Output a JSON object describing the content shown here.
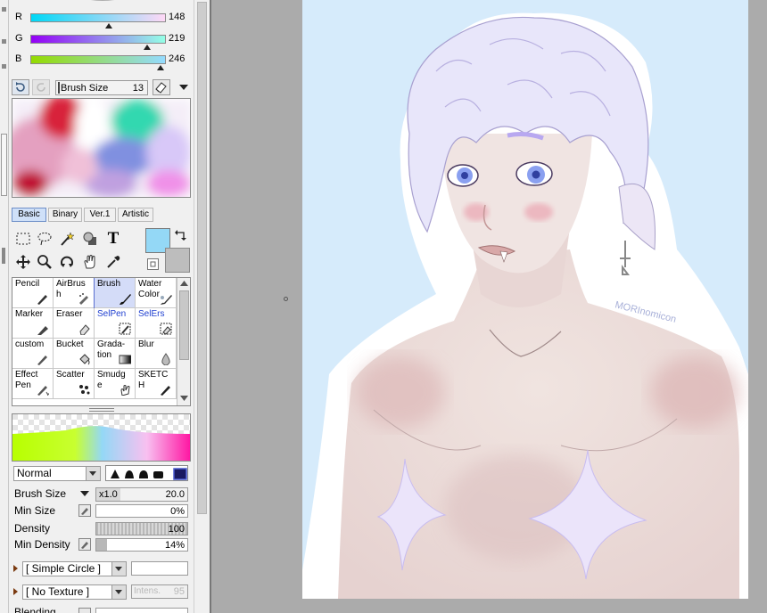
{
  "colors": {
    "accent": "#5a6fd0",
    "main_color": "#94d8f6",
    "sub_color": "#bdbdbd"
  },
  "rgb": [
    {
      "label": "R",
      "value": "148",
      "fraction": 0.58
    },
    {
      "label": "G",
      "value": "219",
      "fraction": 0.86
    },
    {
      "label": "B",
      "value": "246",
      "fraction": 0.96
    }
  ],
  "toolbar": {
    "brush_size_label": "Brush Size",
    "brush_size_value": "13"
  },
  "tabs": [
    {
      "label": "Basic",
      "active": true
    },
    {
      "label": "Binary",
      "active": false
    },
    {
      "label": "Ver.1",
      "active": false
    },
    {
      "label": "Artistic",
      "active": false
    }
  ],
  "tools": {
    "text_tool_glyph": "T"
  },
  "brushes": [
    {
      "label": "Pencil",
      "icon": "pencil-icon"
    },
    {
      "label": "AirBrush",
      "icon": "airbrush-icon"
    },
    {
      "label": "Brush",
      "icon": "brush-icon",
      "active": true
    },
    {
      "label": "Water Color",
      "icon": "watercolor-icon"
    },
    {
      "label": "Marker",
      "icon": "marker-icon"
    },
    {
      "label": "Eraser",
      "icon": "eraser-icon"
    },
    {
      "label": "SelPen",
      "icon": "selpen-icon",
      "blue": true
    },
    {
      "label": "SelErs",
      "icon": "selers-icon",
      "blue": true
    },
    {
      "label": "custom",
      "icon": "custom-pen-icon"
    },
    {
      "label": "Bucket",
      "icon": "bucket-icon"
    },
    {
      "label": "Grada-tion",
      "icon": "gradation-icon"
    },
    {
      "label": "Blur",
      "icon": "blur-icon"
    },
    {
      "label": "Effect Pen",
      "icon": "effect-pen-icon"
    },
    {
      "label": "Scatter",
      "icon": "scatter-icon"
    },
    {
      "label": "Smudge",
      "icon": "smudge-icon"
    },
    {
      "label": "SKETCH",
      "icon": "sketch-icon"
    }
  ],
  "blend_mode": "Normal",
  "properties": {
    "brush_size": {
      "label": "Brush Size",
      "multiplier": "x1.0",
      "value": "20.0"
    },
    "min_size": {
      "label": "Min Size",
      "value": "0%"
    },
    "density": {
      "label": "Density",
      "value": "100"
    },
    "min_density": {
      "label": "Min Density",
      "value": "14%"
    },
    "shape": "[ Simple Circle ]",
    "texture": "[ No Texture ]",
    "intensity": {
      "label": "Intens.",
      "value": "95"
    },
    "partial_label": "Blending"
  },
  "artwork": {
    "signature": "MORInomicon"
  }
}
